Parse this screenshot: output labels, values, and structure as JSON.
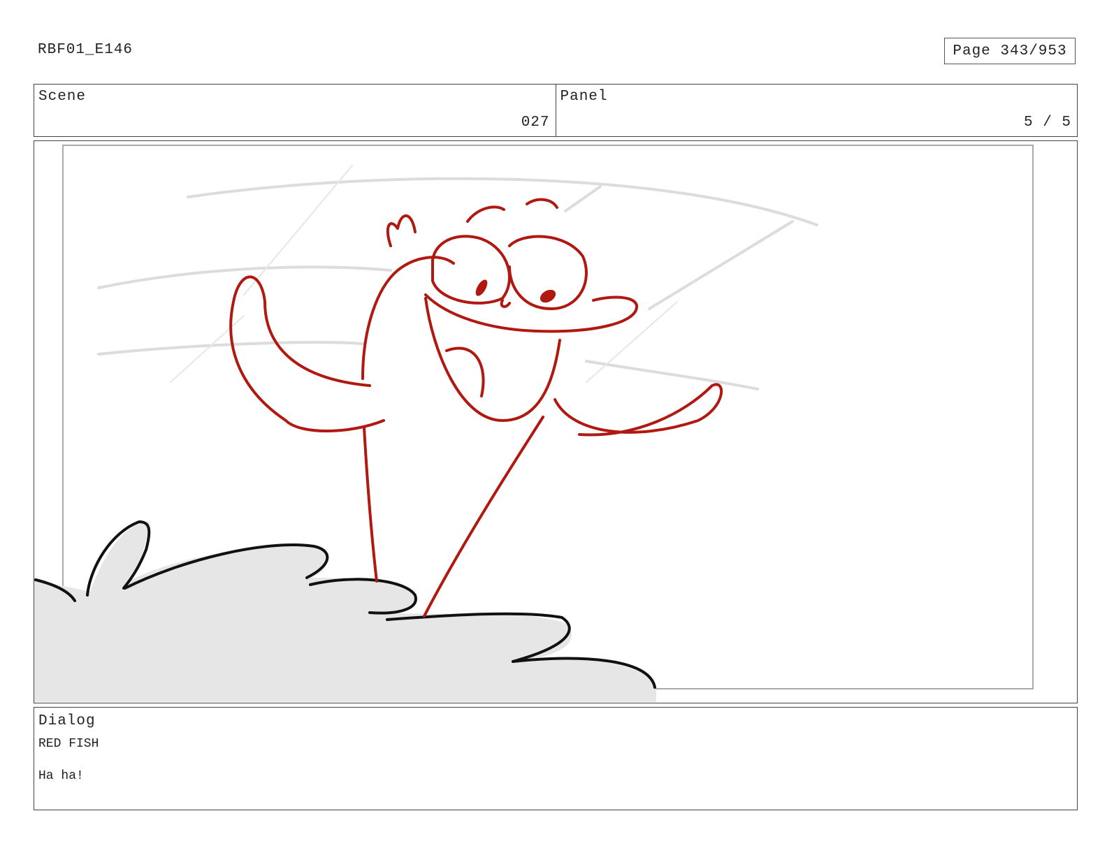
{
  "header": {
    "doc_id": "RBF01_E146",
    "page_label": "Page 343/953"
  },
  "scene": {
    "label": "Scene",
    "value": "027"
  },
  "panel": {
    "label": "Panel",
    "value": "5 / 5"
  },
  "dialog": {
    "label": "Dialog",
    "speaker": "RED FISH",
    "line": "Ha ha!"
  },
  "colors": {
    "character_ink": "#b01810",
    "outline_ink": "#111111",
    "rough_lines": "#dddddd",
    "fill_gray": "#e6e6e6"
  }
}
